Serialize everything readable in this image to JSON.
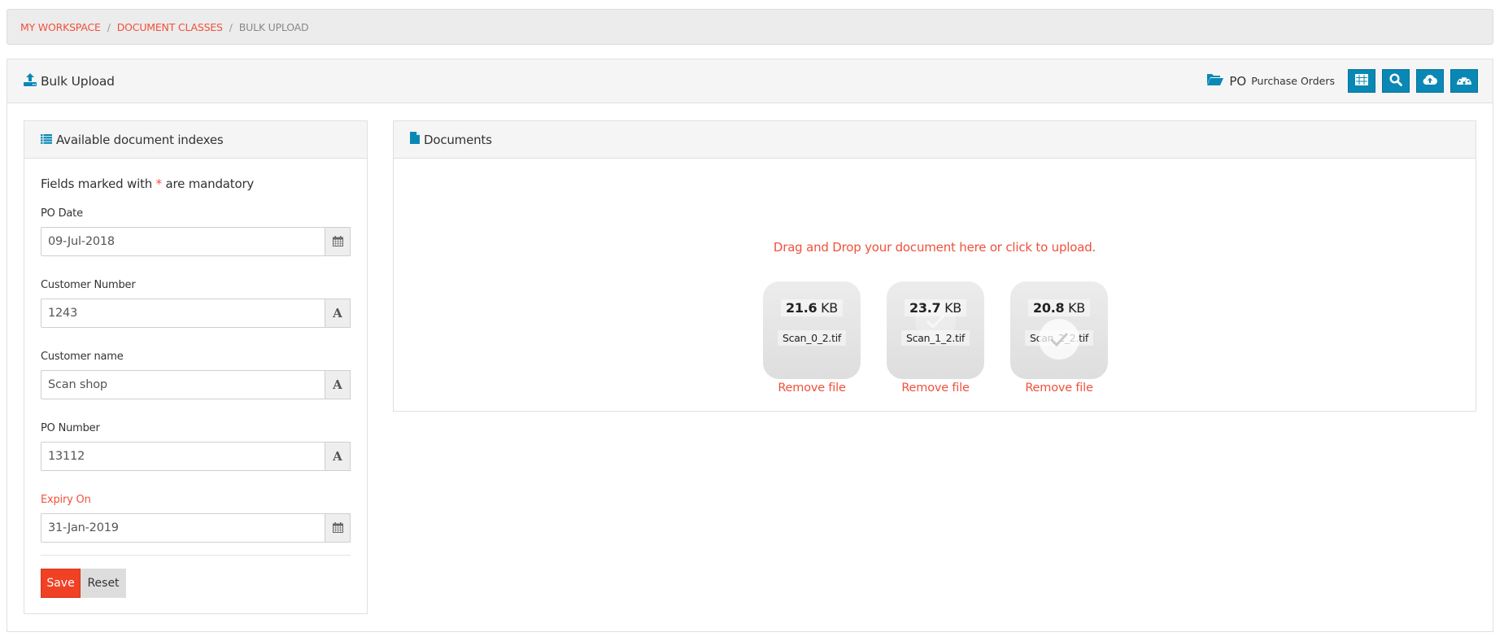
{
  "breadcrumb": {
    "items": [
      "MY WORKSPACE",
      "DOCUMENT CLASSES"
    ],
    "current": "BULK UPLOAD",
    "separator": "/"
  },
  "page": {
    "title": "Bulk Upload",
    "title_icon": "upload-icon",
    "document_class_code": "PO",
    "document_class_name": "Purchase Orders",
    "document_class_icon": "folder-open-icon",
    "toolbar": [
      {
        "name": "table-view",
        "icon": "table-icon"
      },
      {
        "name": "search",
        "icon": "search-icon"
      },
      {
        "name": "upload",
        "icon": "cloud-upload-icon"
      },
      {
        "name": "dashboard",
        "icon": "dashboard-icon"
      }
    ]
  },
  "indexes_panel": {
    "title": "Available document indexes",
    "icon": "list-icon",
    "mandatory_prefix": "Fields marked with",
    "mandatory_star": "*",
    "mandatory_suffix": "are mandatory",
    "fields": [
      {
        "label": "PO Date",
        "value": "09-Jul-2018",
        "addon": "calendar-icon"
      },
      {
        "label": "Customer Number",
        "value": "1243",
        "addon": "text-icon"
      },
      {
        "label": "Customer name",
        "value": "Scan shop",
        "addon": "text-icon"
      },
      {
        "label": "PO Number",
        "value": "13112",
        "addon": "text-icon"
      },
      {
        "label": "Expiry On",
        "value": "31-Jan-2019",
        "addon": "calendar-icon",
        "highlight": true
      }
    ],
    "text_addon_glyph": "A",
    "save_label": "Save",
    "reset_label": "Reset"
  },
  "documents_panel": {
    "title": "Documents",
    "icon": "file-icon",
    "dropzone_message": "Drag and Drop your document here or click to upload.",
    "files": [
      {
        "size_value": "21.6",
        "size_unit": "KB",
        "name": "Scan_0_2.tif",
        "remove_label": "Remove file"
      },
      {
        "size_value": "23.7",
        "size_unit": "KB",
        "name": "Scan_1_2.tif",
        "remove_label": "Remove file"
      },
      {
        "size_value": "20.8",
        "size_unit": "KB",
        "name": "Scan_2_2.tif",
        "remove_label": "Remove file"
      }
    ]
  },
  "colors": {
    "accent": "#f0513b",
    "primary_button": "#0a88b5",
    "save_button": "#f04124"
  }
}
